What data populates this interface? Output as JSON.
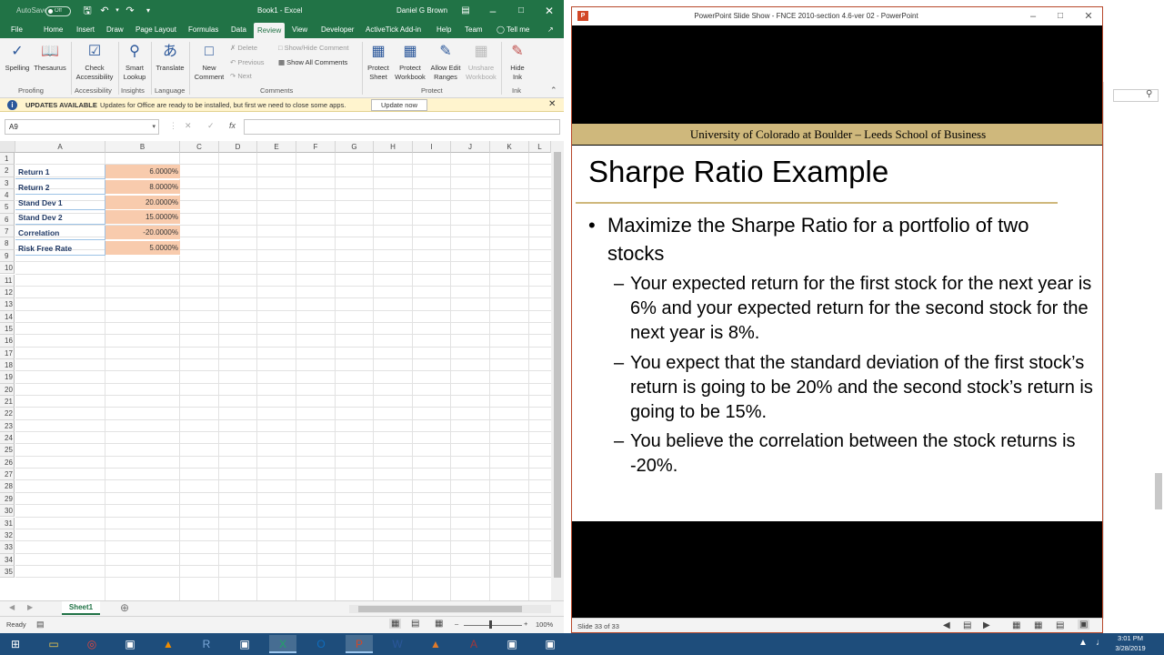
{
  "excel": {
    "window_title": "Book1  -  Excel",
    "autosave_label": "AutoSave",
    "autosave_state": "Off",
    "user_name": "Daniel G Brown",
    "tabs": [
      "File",
      "Home",
      "Insert",
      "Draw",
      "Page Layout",
      "Formulas",
      "Data",
      "Review",
      "View",
      "Developer",
      "ActiveTick Add-in",
      "Help",
      "Team",
      "Tell me"
    ],
    "active_tab": "Review",
    "ribbon": {
      "spelling": "Spelling",
      "thesaurus": "Thesaurus",
      "check_accessibility_1": "Check",
      "check_accessibility_2": "Accessibility",
      "smart_lookup_1": "Smart",
      "smart_lookup_2": "Lookup",
      "translate": "Translate",
      "new_comment_1": "New",
      "new_comment_2": "Comment",
      "delete": "Delete",
      "previous": "Previous",
      "next": "Next",
      "show_hide_comment": "Show/Hide Comment",
      "show_all_comments": "Show All Comments",
      "protect_sheet_1": "Protect",
      "protect_sheet_2": "Sheet",
      "protect_workbook_1": "Protect",
      "protect_workbook_2": "Workbook",
      "allow_edit_1": "Allow Edit",
      "allow_edit_2": "Ranges",
      "unshare_1": "Unshare",
      "unshare_2": "Workbook",
      "hide_ink_1": "Hide",
      "hide_ink_2": "Ink",
      "groups": [
        "Proofing",
        "Accessibility",
        "Insights",
        "Language",
        "Comments",
        "Protect",
        "Ink"
      ]
    },
    "update_bar": {
      "title": "UPDATES AVAILABLE",
      "message": "Updates for Office are ready to be installed, but first we need to close some apps.",
      "button": "Update now"
    },
    "name_box": "A9",
    "formula_content": "",
    "columns": [
      "A",
      "B",
      "C",
      "D",
      "E",
      "F",
      "G",
      "H",
      "I",
      "J",
      "K",
      "L"
    ],
    "rows": [
      "1",
      "2",
      "3",
      "4",
      "5",
      "6",
      "7",
      "8",
      "9",
      "10",
      "11",
      "12",
      "13",
      "14",
      "15",
      "16",
      "17",
      "18",
      "19",
      "20",
      "21",
      "22",
      "23",
      "24",
      "25",
      "26",
      "27",
      "28",
      "29",
      "30",
      "31",
      "32",
      "33",
      "34",
      "35"
    ],
    "cells": [
      {
        "label": "Return 1",
        "value": "6.0000%"
      },
      {
        "label": "Return 2",
        "value": "8.0000%"
      },
      {
        "label": "Stand Dev 1",
        "value": "20.0000%"
      },
      {
        "label": "Stand Dev 2",
        "value": "15.0000%"
      },
      {
        "label": "Correlation",
        "value": "-20.0000%"
      },
      {
        "label": "Risk Free Rate",
        "value": "5.0000%"
      }
    ],
    "sheet_tab": "Sheet1",
    "status": "Ready",
    "zoom": "100%"
  },
  "ppt": {
    "window_title": "PowerPoint Slide Show  -  FNCE 2010-section 4.6-ver 02  -  PowerPoint",
    "banner": "University of Colorado at Boulder – Leeds School of Business",
    "slide_title": "Sharpe Ratio Example",
    "bullet_1": "Maximize the Sharpe Ratio for a portfolio of two stocks",
    "sub_bullets": [
      "Your expected return for the first stock for the next year is 6% and your expected return for the second stock for the next year is 8%.",
      "You expect that the standard deviation of the first stock’s return is going to be 20% and the second stock’s return is going to be 15%.",
      "You believe the correlation between the stock returns is -20%."
    ],
    "bullet_marker": "•",
    "sub_marker": "–",
    "slide_counter": "Slide 33 of 33"
  },
  "taskbar": {
    "time": "3:01 PM",
    "date": "3/28/2019",
    "apps": [
      "start-icon",
      "file-explorer-icon",
      "chrome-icon",
      "app-icon",
      "vlc-icon",
      "r-icon",
      "app-icon",
      "excel-icon",
      "outlook-icon",
      "powerpoint-icon",
      "word-icon",
      "matlab-icon",
      "access-icon",
      "app-icon",
      "app-icon"
    ]
  },
  "colors": {
    "excel_green": "#217346",
    "ppt_orange": "#b7472a",
    "banner_gold": "#cfb87c",
    "cell_fill": "#f8cbad",
    "label_blue": "#1f3864",
    "taskbar": "#1e4d7b"
  }
}
